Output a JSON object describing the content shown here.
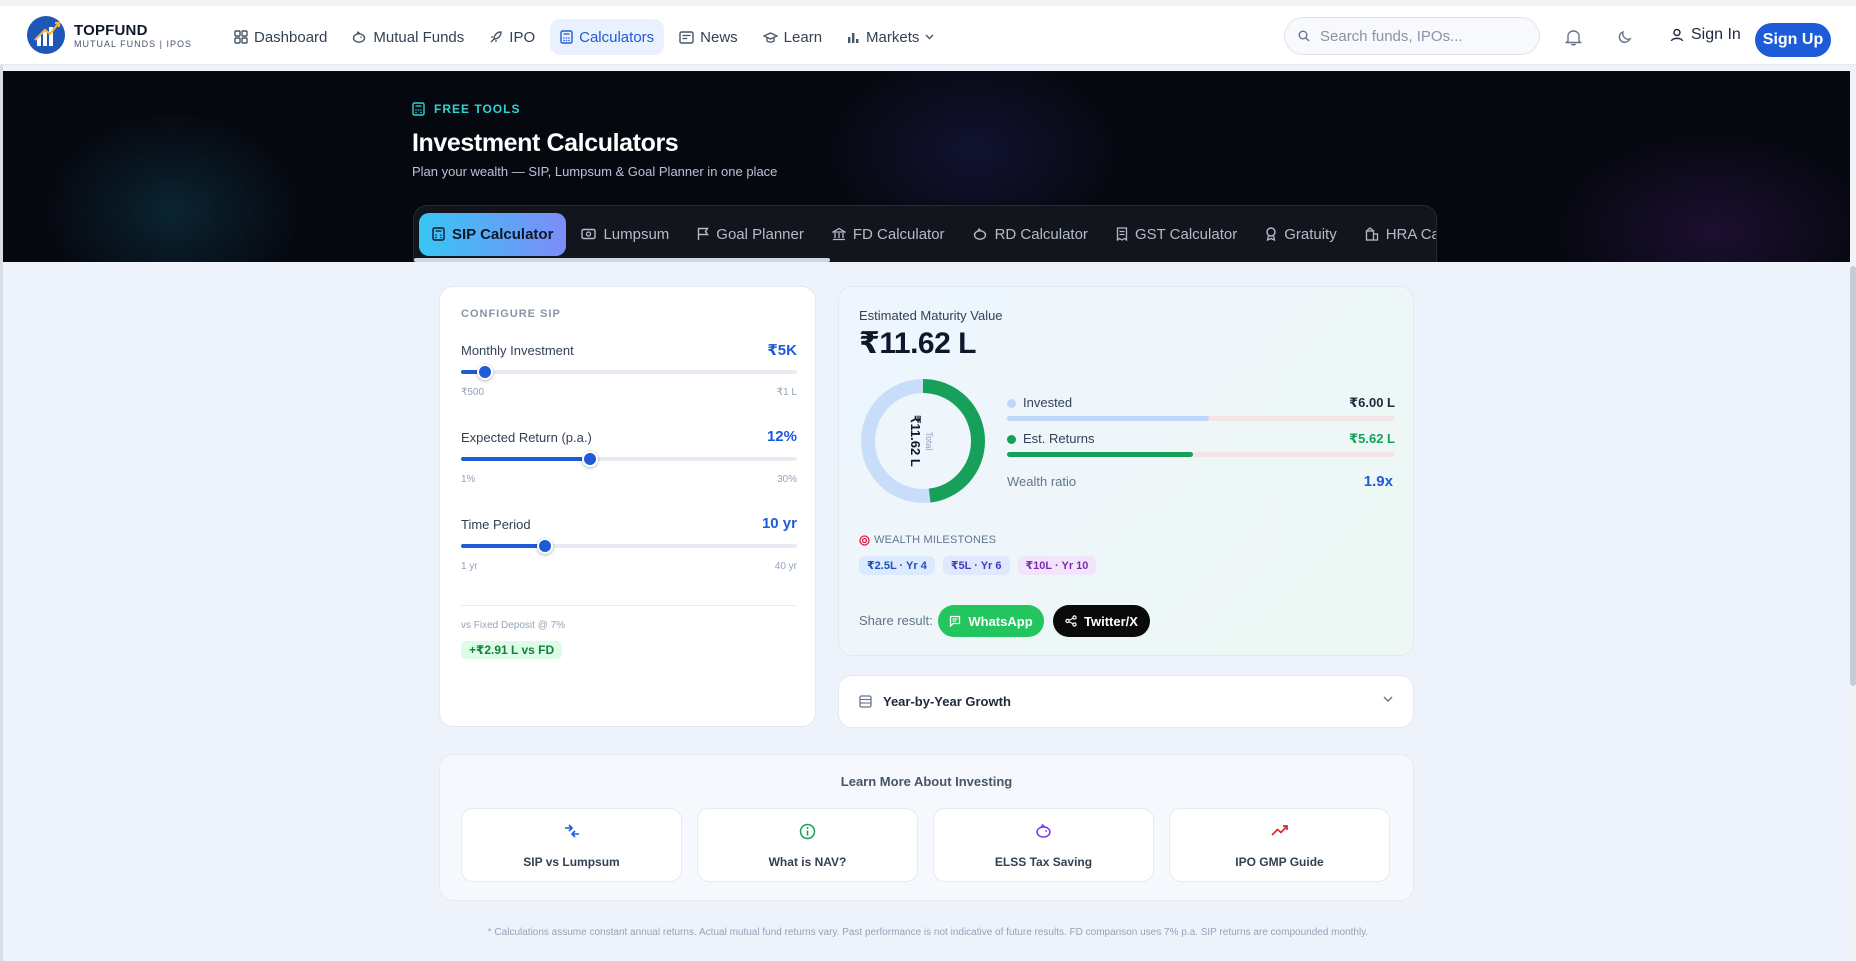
{
  "brand": {
    "name": "TOPFUND",
    "subtitle": "MUTUAL FUNDS | IPOS",
    "color": "#1d5bd8"
  },
  "nav": {
    "items": [
      {
        "label": "Dashboard",
        "icon": "grid-icon",
        "active": false
      },
      {
        "label": "Mutual Funds",
        "icon": "piggy-bank-icon",
        "active": false
      },
      {
        "label": "IPO",
        "icon": "rocket-icon",
        "active": false
      },
      {
        "label": "Calculators",
        "icon": "calculator-icon",
        "active": true
      },
      {
        "label": "News",
        "icon": "newspaper-icon",
        "active": false
      },
      {
        "label": "Learn",
        "icon": "graduation-cap-icon",
        "active": false
      },
      {
        "label": "Markets",
        "icon": "bar-chart-icon",
        "active": false
      }
    ]
  },
  "search": {
    "placeholder": "Search funds, IPOs..."
  },
  "auth": {
    "signin": "Sign In",
    "signup": "Sign Up"
  },
  "hero": {
    "tag": "FREE TOOLS",
    "title": "Investment Calculators",
    "subtitle": "Plan your wealth — SIP, Lumpsum & Goal Planner in one place"
  },
  "tabs": [
    {
      "label": "SIP Calculator",
      "icon": "calculator-icon",
      "active": true
    },
    {
      "label": "Lumpsum",
      "icon": "banknote-icon",
      "active": false
    },
    {
      "label": "Goal Planner",
      "icon": "flag-icon",
      "active": false
    },
    {
      "label": "FD Calculator",
      "icon": "bank-icon",
      "active": false
    },
    {
      "label": "RD Calculator",
      "icon": "piggy-bank-icon",
      "active": false
    },
    {
      "label": "GST Calculator",
      "icon": "receipt-icon",
      "active": false
    },
    {
      "label": "Gratuity",
      "icon": "award-icon",
      "active": false
    },
    {
      "label": "HRA Calc",
      "icon": "building-icon",
      "active": false
    }
  ],
  "config": {
    "title": "CONFIGURE SIP",
    "monthly": {
      "label": "Monthly Investment",
      "value": "₹5K",
      "min": "₹500",
      "max": "₹1 L",
      "fraction": 0.07
    },
    "return": {
      "label": "Expected Return (p.a.)",
      "value": "12%",
      "min": "1%",
      "max": "30%",
      "fraction": 0.385
    },
    "period": {
      "label": "Time Period",
      "value": "10 yr",
      "min": "1 yr",
      "max": "40 yr",
      "fraction": 0.25
    },
    "fd_label": "vs Fixed Deposit @ 7%",
    "fd_badge": "+₹2.91 L vs FD"
  },
  "result": {
    "label": "Estimated Maturity Value",
    "value": "₹11.62 L",
    "donut_total_label": "Total",
    "donut_total_value": "₹11.62 L",
    "invested": {
      "label": "Invested",
      "value": "₹6.00 L",
      "fraction": 0.52,
      "color": "#bfd7f8"
    },
    "returns": {
      "label": "Est. Returns",
      "value": "₹5.62 L",
      "fraction": 0.48,
      "color": "#16a05a"
    },
    "ratio_label": "Wealth ratio",
    "ratio_value": "1.9x",
    "milestones_title": "WEALTH MILESTONES",
    "milestones": [
      "₹2.5L · Yr 4",
      "₹5L · Yr 6",
      "₹10L · Yr 10"
    ],
    "share_label": "Share result:",
    "whatsapp": "WhatsApp",
    "twitter": "Twitter/X"
  },
  "yby": {
    "label": "Year-by-Year Growth"
  },
  "learn": {
    "title": "Learn More About Investing",
    "cards": [
      {
        "label": "SIP vs Lumpsum",
        "icon": "arrows-compare-icon",
        "color": "#1d5bd8"
      },
      {
        "label": "What is NAV?",
        "icon": "info-icon",
        "color": "#16a05a"
      },
      {
        "label": "ELSS Tax Saving",
        "icon": "piggy-bank-icon",
        "color": "#7c3aed"
      },
      {
        "label": "IPO GMP Guide",
        "icon": "trending-up-icon",
        "color": "#dc2626"
      }
    ]
  },
  "footnote": "* Calculations assume constant annual returns. Actual mutual fund returns vary. Past performance is not indicative of future results. FD comparison uses 7% p.a. SIP returns are compounded monthly."
}
